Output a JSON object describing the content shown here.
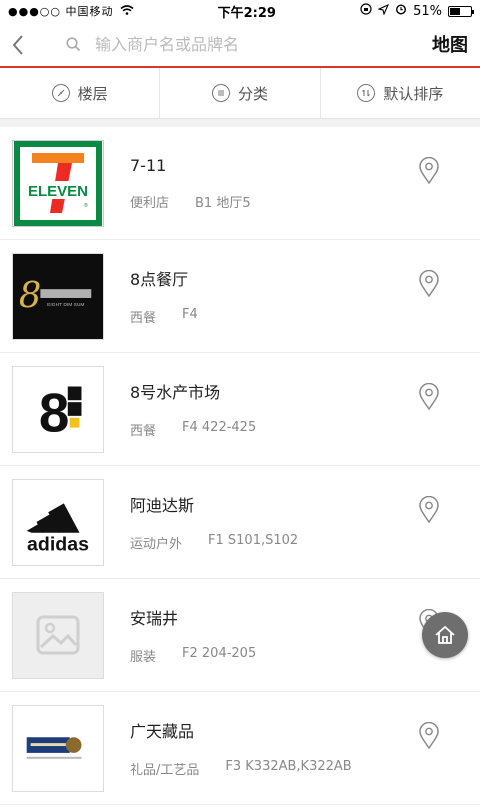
{
  "status": {
    "carrier": "●●●○○ 中国移动",
    "time": "下午2:29",
    "battery": "51%",
    "battery_level": 0.51
  },
  "search": {
    "back_icon": "chevron-left-icon",
    "placeholder": "输入商户名或品牌名",
    "map_label": "地图"
  },
  "filters": [
    {
      "label": "楼层",
      "icon": "floor-icon"
    },
    {
      "label": "分类",
      "icon": "category-icon"
    },
    {
      "label": "默认排序",
      "icon": "sort-icon"
    }
  ],
  "stores": [
    {
      "name": "7-11",
      "category": "便利店",
      "location": "B1 地厅5",
      "logo": "7-eleven-logo"
    },
    {
      "name": "8点餐厅",
      "category": "西餐",
      "location": "F4",
      "logo": "eight-dim-sum-logo",
      "logo_text": "EIGHT DIM SUM"
    },
    {
      "name": "8号水产市场",
      "category": "西餐",
      "location": "F4 422-425",
      "logo": "8-seafood-market-logo"
    },
    {
      "name": "阿迪达斯",
      "category": "运动户外",
      "location": "F1 S101,S102",
      "logo": "adidas-logo"
    },
    {
      "name": "安瑞井",
      "category": "服装",
      "location": "F2 204-205",
      "logo": "placeholder-image-icon"
    },
    {
      "name": "广天藏品",
      "category": "礼品/工艺品",
      "location": "F3 K332AB,K322AB",
      "logo": "guangtian-collection-logo"
    }
  ],
  "colors": {
    "accent": "#d9372b",
    "fab": "#6e6e6e"
  }
}
